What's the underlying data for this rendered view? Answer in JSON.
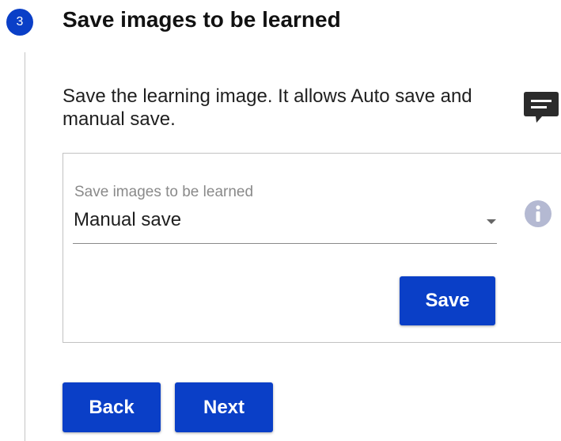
{
  "step": {
    "number": "3",
    "title": "Save images to be learned"
  },
  "description": "Save the learning image. It allows Auto save and manual save.",
  "icons": {
    "help": "speech-bubble-icon",
    "info": "info-icon",
    "caret": "caret-down-icon"
  },
  "save_settings": {
    "field_label": "Save images to be learned",
    "selected_value": "Manual save",
    "save_button": "Save"
  },
  "navigation": {
    "back_button": "Back",
    "next_button": "Next"
  },
  "colors": {
    "accent": "#0a3fc7",
    "info_icon": "#b4b9d2",
    "help_icon": "#2b2b2b"
  }
}
